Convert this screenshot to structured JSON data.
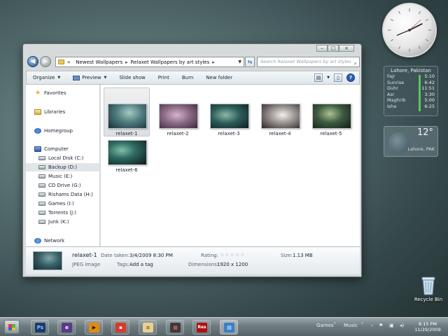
{
  "explorer": {
    "breadcrumb": {
      "overflow": "«",
      "segments": [
        "Newest Wallpapers",
        "Relaxet Wallpapers by art styles"
      ]
    },
    "search_placeholder": "Search Relaxet Wallpapers by art styles",
    "toolbar": {
      "organize": "Organize",
      "preview": "Preview",
      "slideshow": "Slide show",
      "print": "Print",
      "burn": "Burn",
      "new_folder": "New folder"
    },
    "nav": {
      "favorites": "Favorites",
      "libraries": "Libraries",
      "homegroup": "Homegroup",
      "computer": "Computer",
      "drives": [
        "Local Disk (C:)",
        "Backup (D:)",
        "Music (E:)",
        "CD Drive (G:)",
        "Rishams Data (H:)",
        "Games (I:)",
        "Torrents (J:)",
        "Junk (K:)"
      ],
      "network": "Network"
    },
    "files": [
      {
        "name": "relaxet-1",
        "color": "#4e7a7e"
      },
      {
        "name": "relaxet-2",
        "color": "#8b6a86"
      },
      {
        "name": "relaxet-3",
        "color": "#2c5c58"
      },
      {
        "name": "relaxet-4",
        "color": "#a09a98"
      },
      {
        "name": "relaxet-5",
        "color": "#3c5a40"
      },
      {
        "name": "relaxet-6",
        "color": "#2f6a62"
      }
    ],
    "details": {
      "name": "relaxet-1",
      "type": "JPEG image",
      "date_label": "Date taken:",
      "date_value": "3/4/2009 8:30 PM",
      "tags_label": "Tags:",
      "tags_value": "Add a tag",
      "rating_label": "Rating:",
      "rating_stars": "☆☆☆☆☆",
      "dimensions_label": "Dimensions:",
      "dimensions_value": "1920 x 1200",
      "size_label": "Size:",
      "size_value": "1.13 MB"
    }
  },
  "prayer_gadget": {
    "title": "Lahore, Pakistan",
    "rows": [
      {
        "name": "Fajr",
        "time": "5:10"
      },
      {
        "name": "Sunrise",
        "time": "6:42"
      },
      {
        "name": "Duhr",
        "time": "11:51"
      },
      {
        "name": "Asr",
        "time": "3:30"
      },
      {
        "name": "Maghrib",
        "time": "5:00"
      },
      {
        "name": "Isha",
        "time": "6:25"
      }
    ]
  },
  "weather_gadget": {
    "temp": "12°",
    "city": "Lahore, PAK"
  },
  "desktop": {
    "recycle_bin": "Recycle Bin"
  },
  "taskbar": {
    "tray_games": "Games",
    "tray_music": "Music",
    "time": "8:15 PM",
    "date": "11/29/2009"
  }
}
